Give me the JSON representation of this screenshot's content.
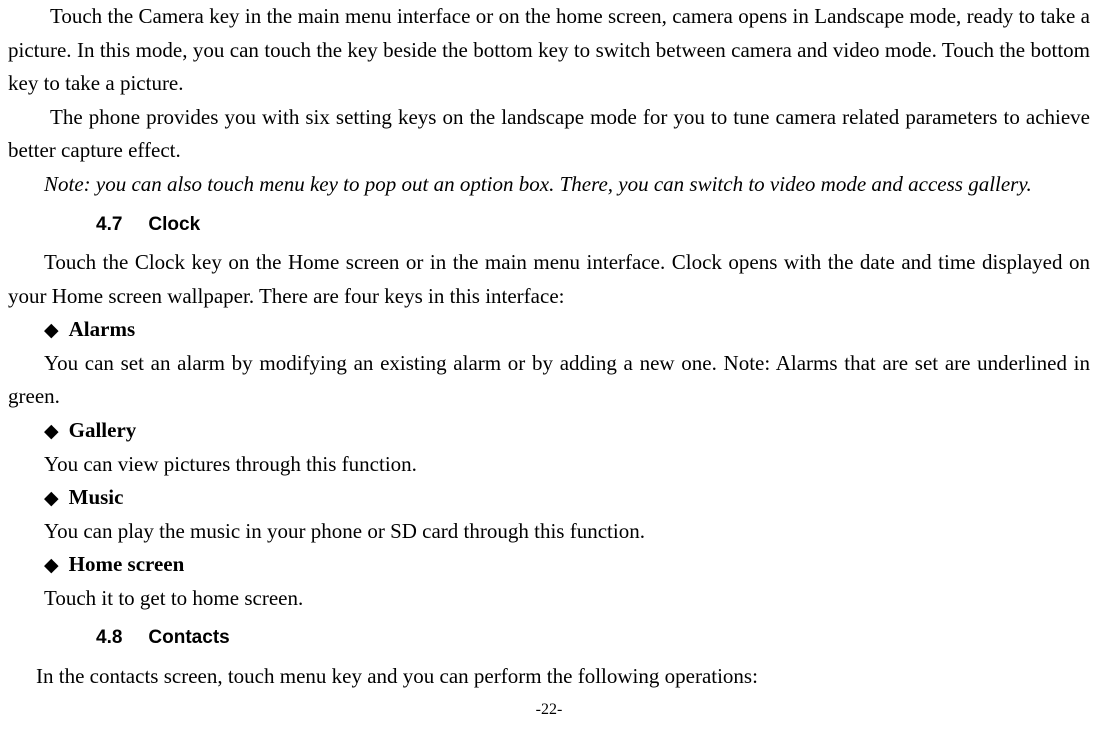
{
  "paragraphs": {
    "p1": "Touch the Camera key in the main menu interface or on the home screen, camera opens in Landscape mode, ready to take a picture. In this mode, you can touch the key beside the bottom key to switch between camera and video mode. Touch the bottom key to take a picture.",
    "p2": "The phone provides you with six setting keys on the landscape mode for you to tune camera related parameters to achieve better capture effect.",
    "note": "Note: you can also touch menu key to pop out an option box. There, you can switch to video mode and access gallery."
  },
  "sections": {
    "s1": {
      "num": "4.7",
      "title": "Clock"
    },
    "s2": {
      "num": "4.8",
      "title": "Contacts"
    }
  },
  "clock": {
    "intro": "Touch the Clock key on the Home screen or in the main menu interface. Clock opens with the date and time displayed on your Home screen wallpaper. There are four keys in this interface:",
    "items": {
      "alarms": {
        "label": "Alarms",
        "text": "You can set an alarm by modifying an existing alarm or by adding a new one. Note: Alarms that are set are underlined in green."
      },
      "gallery": {
        "label": "Gallery",
        "text": "You can view pictures through this function."
      },
      "music": {
        "label": "Music",
        "text": "You can play the music in your phone or SD card through this function."
      },
      "home": {
        "label": "Home screen",
        "text": "Touch it to get to home screen."
      }
    }
  },
  "contacts": {
    "intro": "In the contacts screen, touch menu key and you can perform the following operations:"
  },
  "bullet": "◆",
  "pageNumber": "-22-"
}
